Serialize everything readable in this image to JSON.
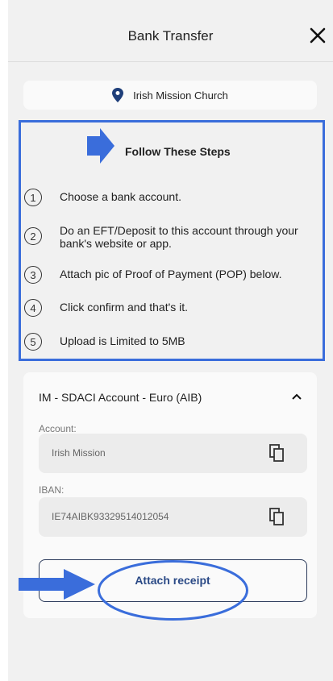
{
  "header": {
    "title": "Bank Transfer",
    "close_icon": "close-icon"
  },
  "location": {
    "icon": "map-pin-icon",
    "name": "Irish Mission Church"
  },
  "steps": {
    "title": "Follow These Steps",
    "items": [
      {
        "num": "1",
        "text": "Choose a bank account."
      },
      {
        "num": "2",
        "text": "Do an EFT/Deposit to this account through your bank's website or app."
      },
      {
        "num": "3",
        "text": "Attach pic of Proof of Payment (POP) below."
      },
      {
        "num": "4",
        "text": "Click confirm and that's it."
      },
      {
        "num": "5",
        "text": "Upload is Limited to 5MB"
      }
    ]
  },
  "account": {
    "name": "IM - SDACI Account - Euro (AIB)",
    "account_label": "Account:",
    "account_value": "Irish Mission",
    "iban_label": "IBAN:",
    "iban_value": "IE74AIBK93329514012054",
    "attach_label": "Attach receipt"
  },
  "colors": {
    "annotation_blue": "#3a6ddb",
    "button_text": "#2b4a86",
    "pin_blue": "#1f3f7a"
  }
}
